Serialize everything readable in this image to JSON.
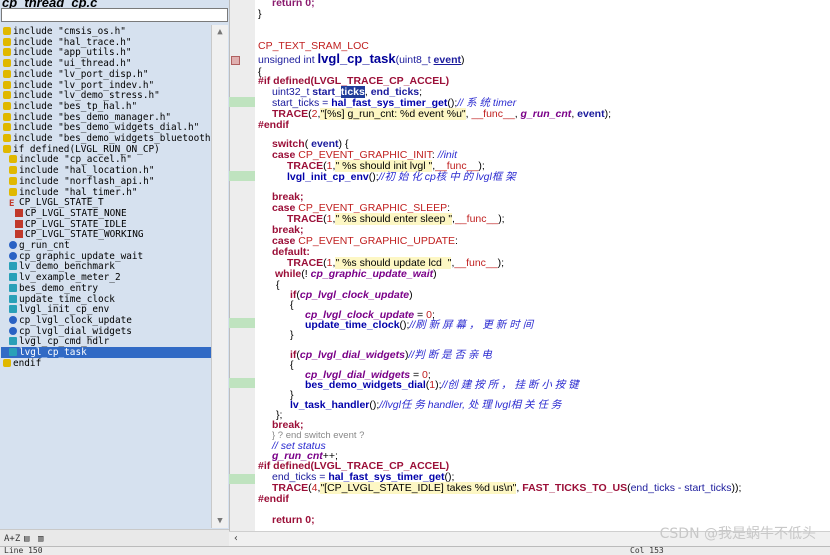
{
  "sidebar": {
    "file_title": "cp_thread_cp.c",
    "symbols": [
      {
        "icon": "include",
        "text": "include \"cmsis_os.h\""
      },
      {
        "icon": "include",
        "text": "include \"hal_trace.h\""
      },
      {
        "icon": "include",
        "text": "include \"app_utils.h\""
      },
      {
        "icon": "include",
        "text": "include \"ui_thread.h\""
      },
      {
        "icon": "include",
        "text": "include \"lv_port_disp.h\""
      },
      {
        "icon": "include",
        "text": "include \"lv_port_indev.h\""
      },
      {
        "icon": "include",
        "text": "include \"lv_demo_stress.h\""
      },
      {
        "icon": "include",
        "text": "include \"bes_tp_hal.h\""
      },
      {
        "icon": "include",
        "text": "include \"bes_demo_manager.h\""
      },
      {
        "icon": "include",
        "text": "include \"bes_demo_widgets_dial.h\""
      },
      {
        "icon": "include",
        "text": "include \"bes_demo_widgets_bluetooth."
      },
      {
        "icon": "include",
        "text": "if defined(LVGL_RUN_ON_CP)"
      },
      {
        "icon": "include",
        "indent": 1,
        "text": "include \"cp_accel.h\""
      },
      {
        "icon": "include",
        "indent": 1,
        "text": "include \"hal_location.h\""
      },
      {
        "icon": "include",
        "indent": 1,
        "text": "include \"norflash_api.h\""
      },
      {
        "icon": "include",
        "indent": 1,
        "text": "include \"hal_timer.h\""
      },
      {
        "icon": "struct",
        "indent": 1,
        "text": "CP_LVGL_STATE_T"
      },
      {
        "icon": "enum",
        "indent": 2,
        "text": "CP_LVGL_STATE_NONE"
      },
      {
        "icon": "enum",
        "indent": 2,
        "text": "CP_LVGL_STATE_IDLE"
      },
      {
        "icon": "enum",
        "indent": 2,
        "text": "CP_LVGL_STATE_WORKING"
      },
      {
        "icon": "var",
        "indent": 1,
        "text": "g_run_cnt"
      },
      {
        "icon": "var",
        "indent": 1,
        "text": "cp_graphic_update_wait"
      },
      {
        "icon": "fn",
        "indent": 1,
        "text": "lv_demo_benchmark"
      },
      {
        "icon": "fn",
        "indent": 1,
        "text": "lv_example_meter_2"
      },
      {
        "icon": "fn",
        "indent": 1,
        "text": "bes_demo_entry"
      },
      {
        "icon": "fn",
        "indent": 1,
        "text": "update_time_clock"
      },
      {
        "icon": "fn",
        "indent": 1,
        "text": "lvgl_init_cp_env"
      },
      {
        "icon": "var",
        "indent": 1,
        "text": "cp_lvgl_clock_update"
      },
      {
        "icon": "var",
        "indent": 1,
        "text": "cp_lvgl_dial_widgets"
      },
      {
        "icon": "fn",
        "indent": 1,
        "text": "lvgl_cp_cmd_hdlr"
      },
      {
        "icon": "fn",
        "indent": 1,
        "text": "lvgl_cp_task",
        "selected": true
      },
      {
        "icon": "include",
        "text": "endif"
      }
    ],
    "bottom_labels": [
      "A+Z",
      "▤",
      "▥"
    ]
  },
  "code": {
    "lines": [
      "return 0;",
      "}",
      "",
      "",
      "CP_TEXT_SRAM_LOC",
      "unsigned int lvgl_cp_task(uint8_t event)",
      "{",
      "#if defined(LVGL_TRACE_CP_ACCEL)",
      "uint32_t start_ticks, end_ticks;",
      "start_ticks = hal_fast_sys_timer_get();// 系 统 timer",
      "TRACE(2,\"[%s] g_run_cnt: %d event %u\", __func__, g_run_cnt, event);",
      "#endif",
      "",
      "switch( event) {",
      "case CP_EVENT_GRAPHIC_INIT: //init",
      "TRACE(1,\" %s should init lvgl \",__func__);",
      "lvgl_init_cp_env();//初 始 化 cp核 中 的 lvgl框 架",
      "",
      "break;",
      "case CP_EVENT_GRAPHIC_SLEEP:",
      "TRACE(1,\" %s should enter sleep \",__func__);",
      "break;",
      "case CP_EVENT_GRAPHIC_UPDATE:",
      "default:",
      "TRACE(1,\" %s should update lcd  \",__func__);",
      "while(! cp_graphic_update_wait)",
      "{",
      "if(cp_lvgl_clock_update)",
      "{",
      "cp_lvgl_clock_update = 0;",
      "update_time_clock();//刷 新 屏 幕 ， 更 新 时 间",
      "}",
      "",
      "if(cp_lvgl_dial_widgets)//判 断 是 否 亲 电",
      "{",
      "cp_lvgl_dial_widgets = 0;",
      "bes_demo_widgets_dial(1);//创 建 按 所 ， 挂 断 小 按 键",
      "}",
      "lv_task_handler();//lvgl任 务 handler, 处 理 lvgl相 关 任 务",
      "};",
      "break;",
      "} ? end switch event ?",
      "// set status",
      "g_run_cnt++;",
      "#if defined(LVGL_TRACE_CP_ACCEL)",
      "end_ticks = hal_fast_sys_timer_get();",
      "TRACE(4,\"[CP_LVGL_STATE_IDLE] takes %d us\\n\", FAST_TICKS_TO_US(end_ticks - start_ticks));",
      "#endif",
      "",
      "return 0;"
    ]
  },
  "status": {
    "left": "Line 150",
    "right": "Col 153"
  },
  "watermark": "CSDN @我是蜗牛不低头"
}
